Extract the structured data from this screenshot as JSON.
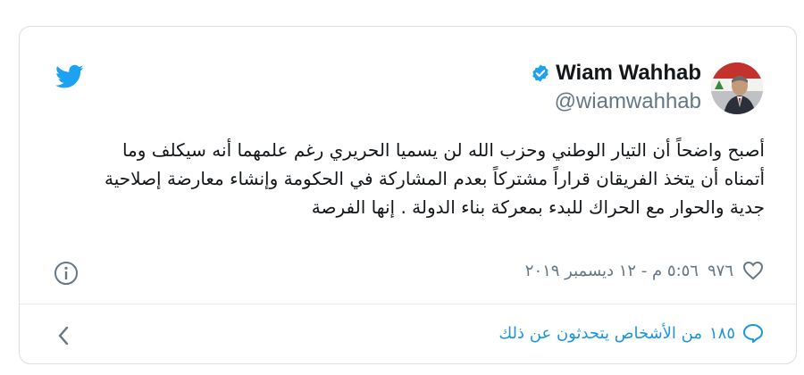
{
  "colors": {
    "brand_blue": "#1da1f2",
    "link_blue": "#1b95e0",
    "text_primary": "#14171a",
    "text_secondary": "#657786",
    "border": "#d9dfe4"
  },
  "icons": {
    "logo": "twitter-bird-icon",
    "verified": "verified-badge-icon",
    "like": "heart-icon",
    "info": "info-icon",
    "reply": "speech-bubble-icon",
    "nav": "chevron-left-icon"
  },
  "author": {
    "display_name": "Wiam Wahhab",
    "handle": "@wiamwahhab",
    "verified": true
  },
  "tweet": {
    "lines": [
      "أصبح واضحاً أن التيار الوطني وحزب الله لن يسميا الحريري رغم علمهما أنه سيكلف وما",
      "أتمناه أن يتخذ الفريقان قراراً مشتركاً بعدم المشاركة في الحكومة وإنشاء معارضة إصلاحية",
      "جدية والحوار مع الحراك للبدء بمعركة بناء الدولة . إنها الفرصة"
    ]
  },
  "meta": {
    "likes": "٩٧٦",
    "timestamp": "٥:٥٦ م - ١٢ ديسمبر ٢٠١٩"
  },
  "footer": {
    "talking_count": "١٨٥",
    "talking_label": "من الأشخاص يتحدثون عن ذلك"
  }
}
